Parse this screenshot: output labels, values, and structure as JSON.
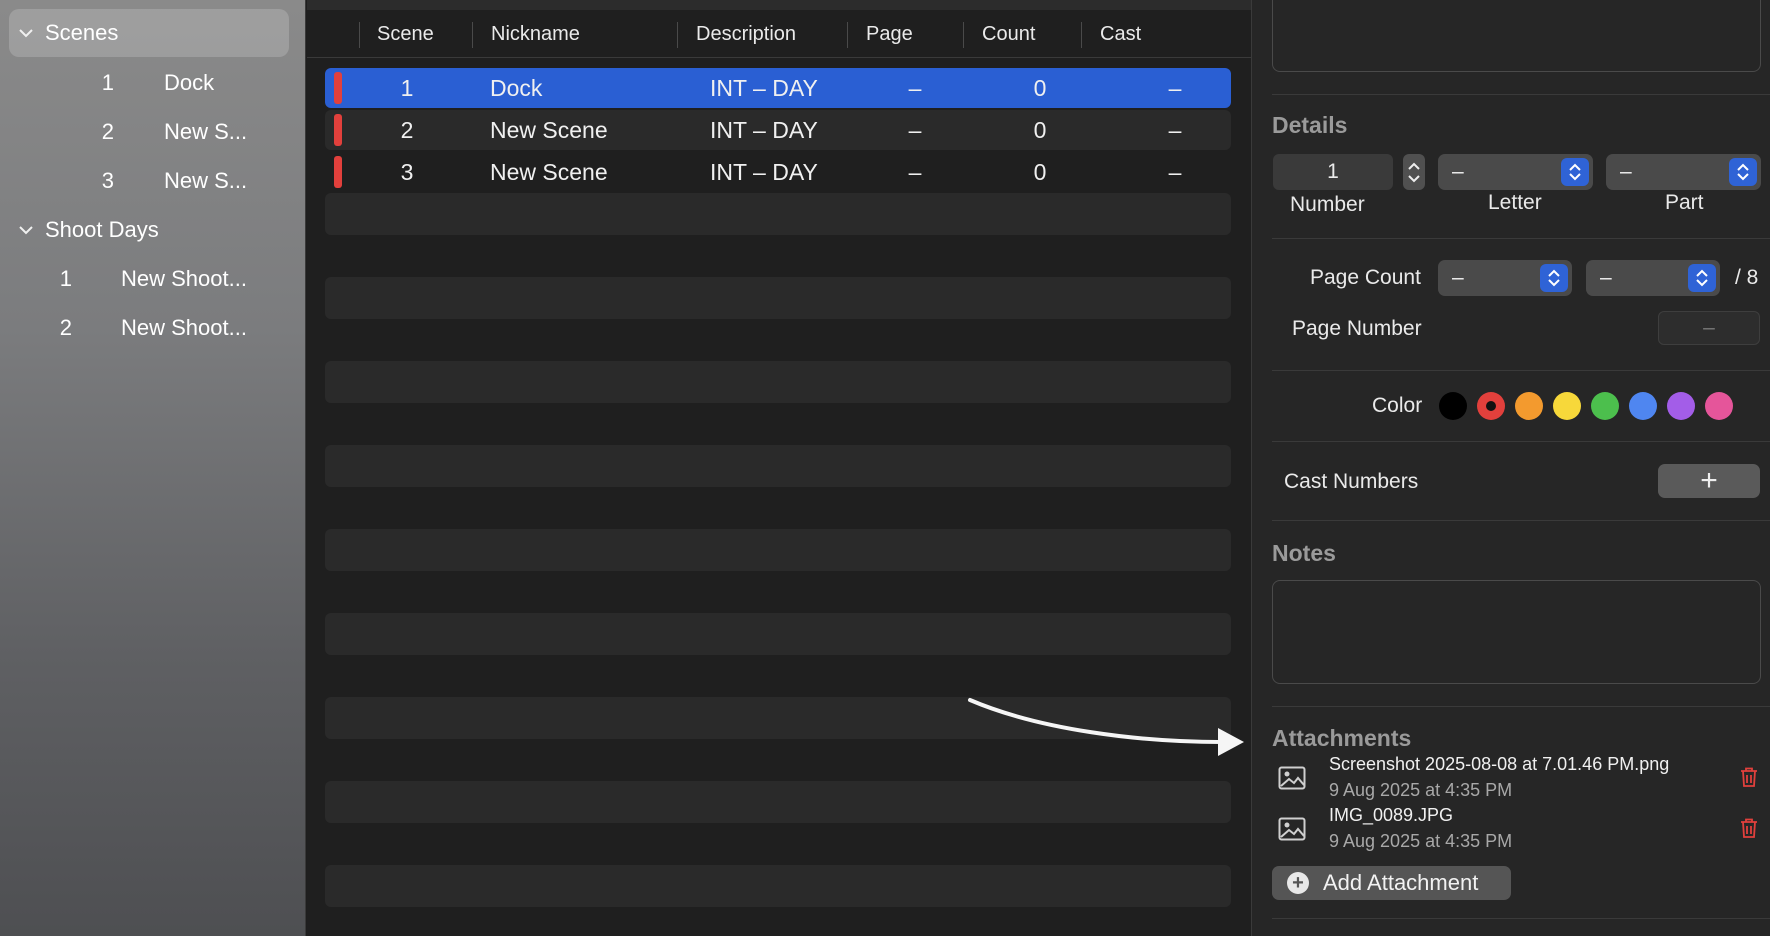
{
  "sidebar": {
    "sections": [
      {
        "label": "Scenes",
        "items": [
          {
            "num": "1",
            "name": "Dock"
          },
          {
            "num": "2",
            "name": "New S..."
          },
          {
            "num": "3",
            "name": "New S..."
          }
        ]
      },
      {
        "label": "Shoot Days",
        "items": [
          {
            "num": "1",
            "name": "New Shoot..."
          },
          {
            "num": "2",
            "name": "New Shoot..."
          }
        ]
      }
    ]
  },
  "table": {
    "columns": [
      "Scene",
      "Nickname",
      "Description",
      "Page",
      "Count",
      "Cast"
    ],
    "rows": [
      {
        "scene": "1",
        "nickname": "Dock",
        "description": "INT – DAY",
        "page": "–",
        "count": "0",
        "cast": "–"
      },
      {
        "scene": "2",
        "nickname": "New Scene",
        "description": "INT – DAY",
        "page": "–",
        "count": "0",
        "cast": "–"
      },
      {
        "scene": "3",
        "nickname": "New Scene",
        "description": "INT – DAY",
        "page": "–",
        "count": "0",
        "cast": "–"
      }
    ],
    "marker_color": "#e2403c",
    "selection_color": "#2a5fd3"
  },
  "inspector": {
    "details": {
      "title": "Details",
      "number_value": "1",
      "number_label": "Number",
      "letter_value": "–",
      "letter_label": "Letter",
      "part_value": "–",
      "part_label": "Part"
    },
    "page_count": {
      "label": "Page Count",
      "value_a": "–",
      "value_b": "–",
      "suffix": "/ 8"
    },
    "page_number": {
      "label": "Page Number",
      "value": "–"
    },
    "color": {
      "label": "Color",
      "swatches": [
        "#000000",
        "#e2403c",
        "#f39a2e",
        "#f7d83a",
        "#4cbf4d",
        "#4f86f0",
        "#a35de8",
        "#e5559a"
      ],
      "selected_index": 1
    },
    "cast_numbers": {
      "label": "Cast Numbers",
      "add_glyph": "+"
    },
    "notes": {
      "title": "Notes"
    },
    "attachments": {
      "title": "Attachments",
      "items": [
        {
          "name": "Screenshot 2025-08-08 at 7.01.46 PM.png",
          "date": "9 Aug 2025 at 4:35 PM"
        },
        {
          "name": "IMG_0089.JPG",
          "date": "9 Aug 2025 at 4:35 PM"
        }
      ],
      "add_label": "Add Attachment",
      "delete_color": "#e2403c"
    }
  }
}
